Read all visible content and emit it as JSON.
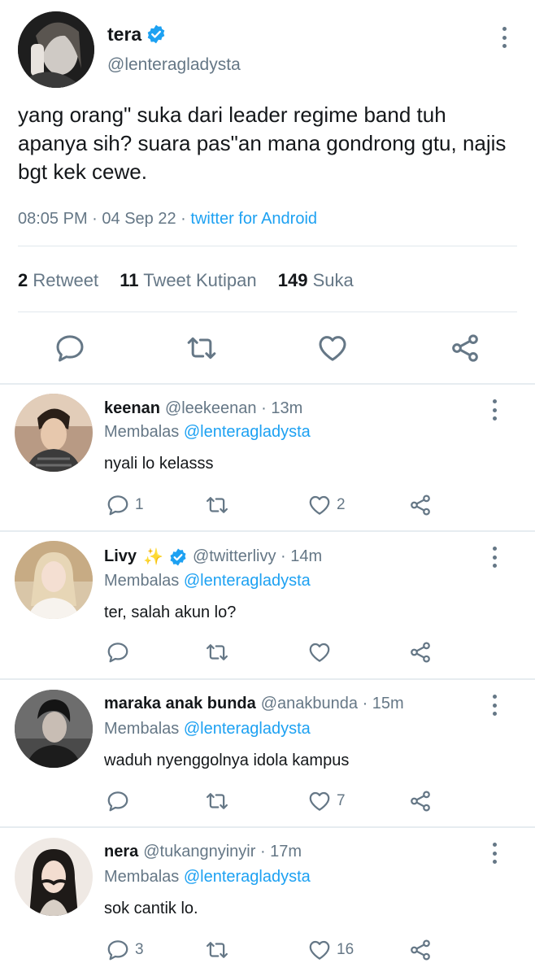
{
  "main_tweet": {
    "name": "tera",
    "handle": "@lenteragladysta",
    "text": "yang orang\" suka dari leader regime band tuh apanya sih? suara pas\"an mana gondrong gtu, najis bgt kek cewe.",
    "time": "08:05 PM",
    "date": "04 Sep 22",
    "source": "twitter for Android",
    "meta_sep": "·",
    "stats": {
      "retweets_count": "2",
      "retweets_label": "Retweet",
      "quotes_count": "11",
      "quotes_label": "Tweet Kutipan",
      "likes_count": "149",
      "likes_label": "Suka"
    }
  },
  "replies": [
    {
      "name": "keenan",
      "handle": "@leekeenan · 13m",
      "replying_prefix": "Membalas",
      "replying_to": "@lenteragladysta",
      "text": "nyali lo kelasss",
      "reply_count": "1",
      "retweet_count": "",
      "like_count": "2"
    },
    {
      "name": "Livy",
      "name_emoji": "✨",
      "handle": "@twitterlivy · 14m",
      "replying_prefix": "Membalas",
      "replying_to": "@lenteragladysta",
      "text": "ter, salah akun lo?",
      "reply_count": "",
      "retweet_count": "",
      "like_count": ""
    },
    {
      "name": "maraka anak bunda",
      "handle": "@anakbunda · 15m",
      "replying_prefix": "Membalas",
      "replying_to": "@lenteragladysta",
      "text": "waduh nyenggolnya idola kampus",
      "reply_count": "",
      "retweet_count": "",
      "like_count": "7"
    },
    {
      "name": "nera",
      "handle": "@tukangnyinyir · 17m",
      "replying_prefix": "Membalas",
      "replying_to": "@lenteragladysta",
      "text": "sok cantik lo.",
      "reply_count": "3",
      "retweet_count": "",
      "like_count": "16"
    }
  ],
  "icons": {
    "reply": "reply-icon",
    "retweet": "retweet-icon",
    "like": "heart-icon",
    "share": "share-icon",
    "more": "more-vertical-icon",
    "verified": "verified-badge-icon"
  },
  "colors": {
    "accent": "#1da1f2",
    "text_primary": "#14171a",
    "text_secondary": "#657786",
    "divider": "#e1e8ed"
  }
}
